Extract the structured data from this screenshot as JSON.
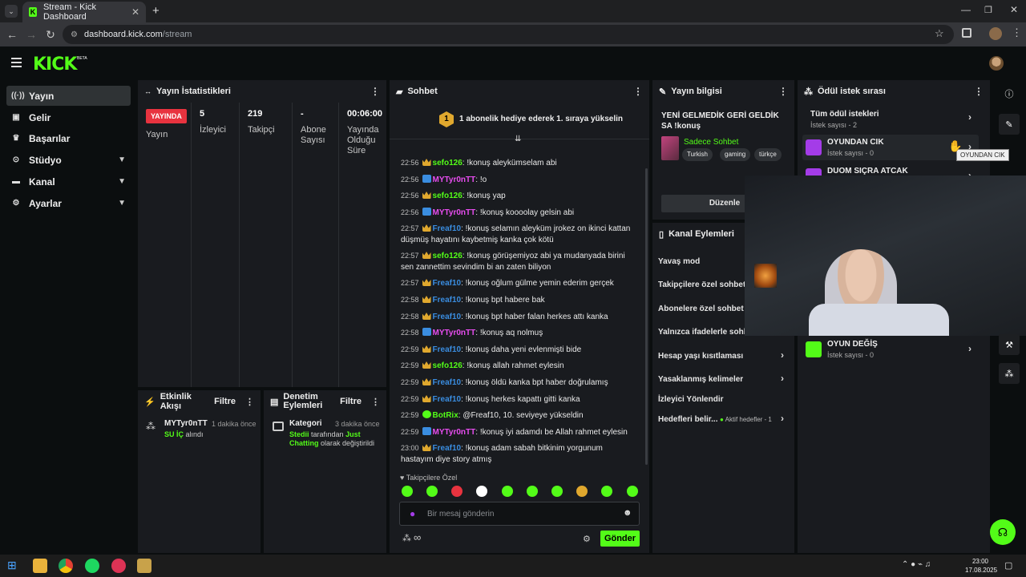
{
  "browser": {
    "tab_title": "Stream - Kick Dashboard",
    "url_domain": "dashboard.kick.com",
    "url_path": "/stream"
  },
  "header": {
    "logo": "KICK",
    "beta": "BETA"
  },
  "sidebar": {
    "items": [
      {
        "label": "Yayın",
        "icon": "broadcast-icon",
        "active": true
      },
      {
        "label": "Gelir",
        "icon": "wallet-icon"
      },
      {
        "label": "Başarılar",
        "icon": "trophy-icon"
      },
      {
        "label": "Stüdyo",
        "icon": "studio-icon",
        "expandable": true
      },
      {
        "label": "Kanal",
        "icon": "channel-icon",
        "expandable": true
      },
      {
        "label": "Ayarlar",
        "icon": "gear-icon",
        "expandable": true
      }
    ]
  },
  "stats": {
    "title": "Yayın İstatistikleri",
    "live_badge": "YAYINDA",
    "live_label": "Yayın",
    "viewers": {
      "value": "5",
      "label": "İzleyici"
    },
    "followers": {
      "value": "219",
      "label": "Takipçi"
    },
    "subs": {
      "value": "-",
      "label": "Abone Sayısı"
    },
    "uptime": {
      "value": "00:06:00",
      "label": "Yayında Olduğu Süre"
    }
  },
  "activity": {
    "title": "Etkinlik Akışı",
    "filter": "Filtre",
    "item_user": "MYTyr0nTT",
    "item_time": "1 dakika önce",
    "item_highlight": "SU İÇ",
    "item_suffix": "alındı"
  },
  "moderation": {
    "title": "Denetim Eylemleri",
    "filter": "Filtre",
    "item_title": "Kategori",
    "item_time": "3 dakika önce",
    "item_user": "Stedii",
    "item_mid": "tarafından",
    "item_category": "Just Chatting",
    "item_suffix": "olarak değiştirildi"
  },
  "chat": {
    "title": "Sohbet",
    "banner_rank": "1",
    "banner": "1 abonelik hediye ederek 1. sıraya yükselin",
    "messages": [
      {
        "t": "22:56",
        "u": "sefo126",
        "c": "#53fc18",
        "b": "crown",
        "m": "!konuş aleykümselam abi"
      },
      {
        "t": "22:56",
        "u": "MYTyr0nTT",
        "c": "#e84df0",
        "b": "tri",
        "m": "!ο"
      },
      {
        "t": "22:56",
        "u": "sefo126",
        "c": "#53fc18",
        "b": "crown",
        "m": "!konuş yap"
      },
      {
        "t": "22:56",
        "u": "MYTyr0nTT",
        "c": "#e84df0",
        "b": "tri",
        "m": "!konuş koooolay gelsin abi"
      },
      {
        "t": "22:57",
        "u": "Freaf10",
        "c": "#3a8de0",
        "b": "crown",
        "m": "!konuş selamın aleyküm jrokez on ikinci kattan düşmüş hayatını kaybetmiş kanka çok kötü"
      },
      {
        "t": "22:57",
        "u": "sefo126",
        "c": "#53fc18",
        "b": "crown",
        "m": "!konuş görüşemiyoz abi ya mudanyada birini sen zannettim sevindim bi an zaten biliyon"
      },
      {
        "t": "22:57",
        "u": "Freaf10",
        "c": "#3a8de0",
        "b": "crown",
        "m": "!konuş oğlum gülme yemin ederim gerçek"
      },
      {
        "t": "22:58",
        "u": "Freaf10",
        "c": "#3a8de0",
        "b": "crown",
        "m": "!konuş bpt habere bak"
      },
      {
        "t": "22:58",
        "u": "Freaf10",
        "c": "#3a8de0",
        "b": "crown",
        "m": "!konuş bpt haber falan herkes attı kanka"
      },
      {
        "t": "22:58",
        "u": "MYTyr0nTT",
        "c": "#e84df0",
        "b": "tri",
        "m": "!konuş aq nolmuş"
      },
      {
        "t": "22:59",
        "u": "Freaf10",
        "c": "#3a8de0",
        "b": "crown",
        "m": "!konuş daha yeni evlenmişti bide"
      },
      {
        "t": "22:59",
        "u": "sefo126",
        "c": "#53fc18",
        "b": "crown",
        "m": "!konuş allah rahmet eylesin"
      },
      {
        "t": "22:59",
        "u": "Freaf10",
        "c": "#3a8de0",
        "b": "crown",
        "m": "!konuş öldü kanka bpt haber doğrulamış"
      },
      {
        "t": "22:59",
        "u": "Freaf10",
        "c": "#3a8de0",
        "b": "crown",
        "m": "!konuş herkes kapattı gitti kanka"
      },
      {
        "t": "22:59",
        "u": "BotRix",
        "c": "#53fc18",
        "b": "bot",
        "m": "@Freaf10, 10. seviyeye yükseldin"
      },
      {
        "t": "22:59",
        "u": "MYTyr0nTT",
        "c": "#e84df0",
        "b": "tri",
        "m": "!konuş iyi adamdı be Allah rahmet eylesin"
      },
      {
        "t": "23:00",
        "u": "Freaf10",
        "c": "#3a8de0",
        "b": "crown",
        "m": "!konuş adam sabah bitkinim yorgunum hastayım diye story atmış"
      }
    ],
    "followers_only": "Takipçilere Özel",
    "input_placeholder": "Bir mesaj gönderin",
    "send": "Gönder",
    "infinity": "∞"
  },
  "stream_info": {
    "title": "Yayın bilgisi",
    "stream_title": "YENİ GELMEDİK GERİ GELDİK SA !konuş",
    "category": "Sadece Sohbet",
    "tags": [
      "Turkish",
      "gaming",
      "türkçe"
    ],
    "edit": "Düzenle"
  },
  "channel_actions": {
    "title": "Kanal Eylemleri",
    "rows": [
      "Yavaş mod",
      "Takipçilere özel sohbet",
      "Abonelere özel sohbet",
      "Yalnızca ifadelerle sohbet",
      "Hesap yaşı kısıtlaması",
      "Yasaklanmış kelimeler",
      "İzleyici Yönlendir",
      "Hedefleri belir..."
    ],
    "goals_active": "Aktif hedefler - 1"
  },
  "rewards": {
    "title": "Ödül istek sırası",
    "all": "Tüm ödül istekleri",
    "all_count": "İstek sayısı - 2",
    "items": [
      {
        "name": "OYUNDAN CIK",
        "count": "İstek sayısı - 0"
      },
      {
        "name": "DUOM SIÇRA ATCAK",
        "count": ""
      },
      {
        "name": "OYUN DEĞİŞ",
        "count": "İstek sayısı - 0"
      }
    ],
    "tooltip": "OYUNDAN CIK"
  },
  "taskbar": {
    "time": "23:00",
    "date": "17.08.2025"
  }
}
